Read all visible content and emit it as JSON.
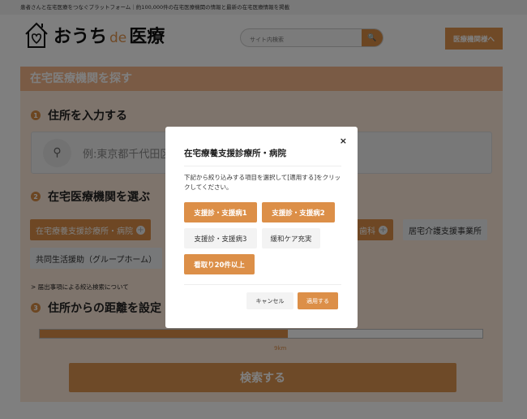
{
  "topbar": {
    "text": "患者さんと在宅医療をつなぐプラットフォーム｜約100,000件の在宅医療機関の情報と最新の在宅医療情報を掲載"
  },
  "header": {
    "logo_text": "おうち",
    "logo_de": "de",
    "logo_text2": "医療",
    "search_placeholder": "サイト内検索",
    "search_icon": "search-icon",
    "medical_button": "医療機関様へ"
  },
  "main": {
    "title": "在宅医療機関を探す",
    "step1": {
      "num": "1",
      "label": "住所を入力する",
      "placeholder": "例:東京都千代田区"
    },
    "step2": {
      "num": "2",
      "label": "在宅医療機関を選ぶ",
      "chips": [
        {
          "label": "在宅療養支援診療所・病院",
          "selected": true
        },
        {
          "label": "歯科",
          "selected": true
        },
        {
          "label": "居宅介護支援事業所",
          "selected": false
        },
        {
          "label": "共同生活援助（グループホーム）",
          "selected": false
        }
      ]
    },
    "filter_link": "> 届出事項による絞込検索について",
    "step3": {
      "num": "3",
      "label": "住所からの距離を設定",
      "distance_percent": 56,
      "distance_label": "9km"
    },
    "search_button": "検索する"
  },
  "modal": {
    "title": "在宅療養支援診療所・病院",
    "close": "×",
    "description": "下記から絞り込みする項目を選択して[適用する]をクリックしてください。",
    "options": [
      {
        "label": "支援診・支援病1",
        "selected": true
      },
      {
        "label": "支援診・支援病2",
        "selected": true
      },
      {
        "label": "支援診・支援病3",
        "selected": false
      },
      {
        "label": "緩和ケア充実",
        "selected": false
      },
      {
        "label": "看取り20件以上",
        "selected": true
      }
    ],
    "cancel": "キャンセル",
    "apply": "適用する"
  },
  "colors": {
    "accent": "#dc8f48",
    "overlay": "rgba(0,0,0,0.5)"
  }
}
